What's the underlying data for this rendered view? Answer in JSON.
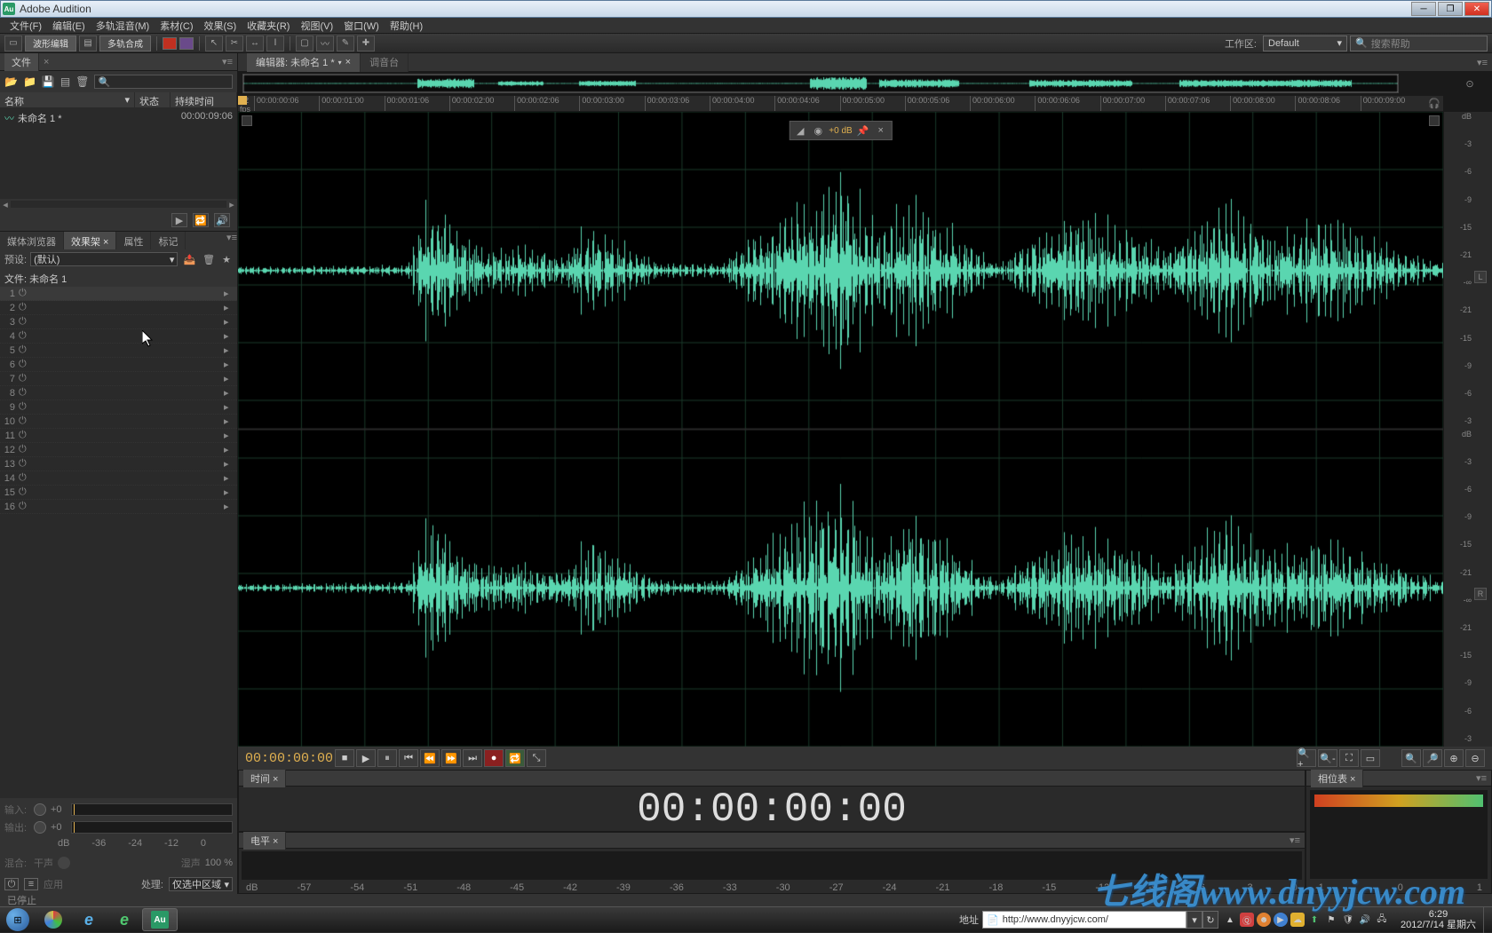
{
  "app": {
    "title": "Adobe Audition"
  },
  "menus": [
    "文件(F)",
    "编辑(E)",
    "多轨混音(M)",
    "素材(C)",
    "效果(S)",
    "收藏夹(R)",
    "视图(V)",
    "窗口(W)",
    "帮助(H)"
  ],
  "toolbar": {
    "waveform_mode": "波形编辑",
    "multitrack_mode": "多轨合成",
    "workspace_label": "工作区:",
    "workspace_value": "Default",
    "search_placeholder": "搜索帮助"
  },
  "files_panel": {
    "tab": "文件",
    "headers": {
      "name": "名称",
      "status": "状态",
      "duration": "持续时间"
    },
    "items": [
      {
        "name": "未命名 1 *",
        "duration": "00:00:09:06"
      }
    ]
  },
  "effects_panel": {
    "tabs": [
      "媒体浏览器",
      "效果架",
      "属性",
      "标记"
    ],
    "active_tab": 1,
    "preset_label": "预设:",
    "preset_value": "(默认)",
    "file_label": "文件: 未命名 1",
    "slots": [
      1,
      2,
      3,
      4,
      5,
      6,
      7,
      8,
      9,
      10,
      11,
      12,
      13,
      14,
      15,
      16
    ],
    "io": {
      "in_label": "输入:",
      "out_label": "输出:",
      "in_val": "+0",
      "out_val": "+0"
    },
    "io_scale": [
      "dB",
      "-36",
      "-24",
      "-12",
      "0"
    ],
    "mix": {
      "label": "混合:",
      "dry": "干声",
      "wet": "湿声",
      "value": "100 %"
    },
    "apply_btn": "应用",
    "process_label": "处理:",
    "process_value": "仅选中区域"
  },
  "editor": {
    "tabs": [
      {
        "label": "编辑器: 未命名 1 *",
        "active": true
      },
      {
        "label": "调音台",
        "active": false
      }
    ],
    "ruler_fps": "12 fps",
    "ruler_ticks": [
      "00:00:00:06",
      "00:00:01:00",
      "00:00:01:06",
      "00:00:02:00",
      "00:00:02:06",
      "00:00:03:00",
      "00:00:03:06",
      "00:00:04:00",
      "00:00:04:06",
      "00:00:05:00",
      "00:00:05:06",
      "00:00:06:00",
      "00:00:06:06",
      "00:00:07:00",
      "00:00:07:06",
      "00:00:08:00",
      "00:00:08:06",
      "00:00:09:00"
    ],
    "volume_db": "+0 dB",
    "db_scale": [
      "dB",
      "-3",
      "-6",
      "-9",
      "-15",
      "-21",
      "-∞",
      "-21",
      "-15",
      "-9",
      "-6",
      "-3"
    ],
    "channels": {
      "left": "L",
      "right": "R"
    },
    "transport_time": "00:00:00:00"
  },
  "time_panel": {
    "tab": "时间",
    "big_time": "00:00:00:00"
  },
  "level_panel": {
    "tab": "电平",
    "scale": [
      "dB",
      "-57",
      "-54",
      "-51",
      "-48",
      "-45",
      "-42",
      "-39",
      "-36",
      "-33",
      "-30",
      "-27",
      "-24",
      "-21",
      "-18",
      "-15",
      "-12",
      "-9",
      "-6",
      "-3",
      "0"
    ]
  },
  "phase_panel": {
    "tab": "相位表",
    "scale": [
      "-1",
      "0",
      "1"
    ]
  },
  "status": {
    "text": "已停止"
  },
  "taskbar": {
    "address_label": "地址",
    "url": "http://www.dnyyjcw.com/",
    "time": "6:29",
    "date": "2012/7/14",
    "day": "星期六"
  },
  "watermark": "七线阁www.dnyyjcw.com"
}
